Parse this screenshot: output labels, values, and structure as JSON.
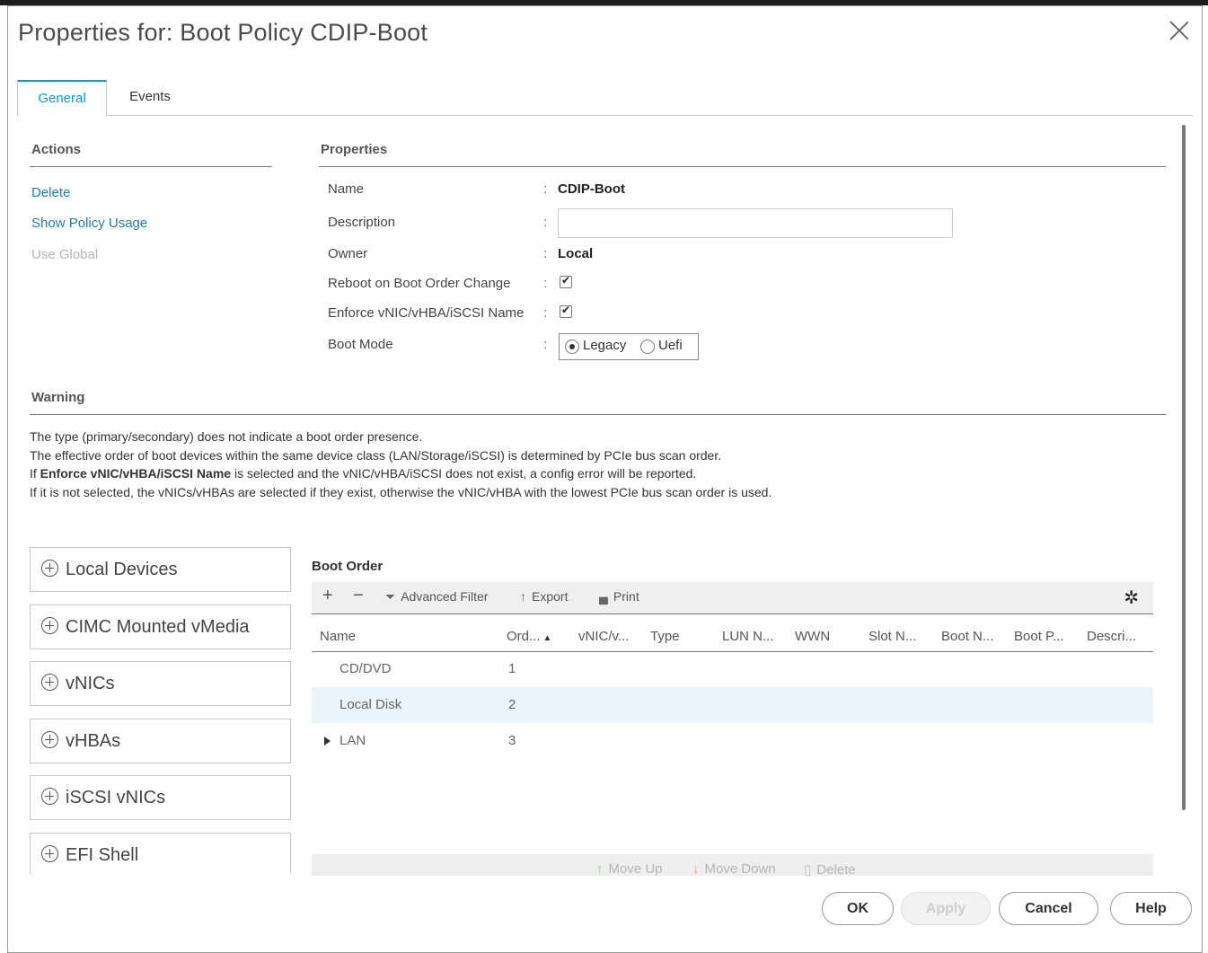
{
  "dialog": {
    "title": "Properties for: Boot Policy CDIP-Boot"
  },
  "tabs": [
    {
      "label": "General",
      "active": true
    },
    {
      "label": "Events",
      "active": false
    }
  ],
  "actions": {
    "header": "Actions",
    "items": [
      {
        "label": "Delete",
        "enabled": true
      },
      {
        "label": "Show Policy Usage",
        "enabled": true
      },
      {
        "label": "Use Global",
        "enabled": false
      }
    ]
  },
  "properties": {
    "header": "Properties",
    "name_label": "Name",
    "name_value": "CDIP-Boot",
    "description_label": "Description",
    "description_value": "",
    "owner_label": "Owner",
    "owner_value": "Local",
    "reboot_label": "Reboot on Boot Order Change",
    "reboot_checked": true,
    "enforce_label": "Enforce vNIC/vHBA/iSCSI Name",
    "enforce_checked": true,
    "boot_mode_label": "Boot Mode",
    "boot_mode_options": [
      "Legacy",
      "Uefi"
    ],
    "boot_mode_selected": "Legacy"
  },
  "warning": {
    "header": "Warning",
    "line1": "The type (primary/secondary) does not indicate a boot order presence.",
    "line2": "The effective order of boot devices within the same device class (LAN/Storage/iSCSI) is determined by PCIe bus scan order.",
    "line3_prefix": "If ",
    "line3_bold": "Enforce vNIC/vHBA/iSCSI Name",
    "line3_suffix": " is selected and the vNIC/vHBA/iSCSI does not exist, a config error will be reported.",
    "line4": "If it is not selected, the vNICs/vHBAs are selected if they exist, otherwise the vNIC/vHBA with the lowest PCIe bus scan order is used."
  },
  "devices": [
    "Local Devices",
    "CIMC Mounted vMedia",
    "vNICs",
    "vHBAs",
    "iSCSI vNICs",
    "EFI Shell"
  ],
  "boot_order": {
    "title": "Boot Order",
    "toolbar": {
      "add": "+",
      "remove": "−",
      "advanced_filter": "Advanced Filter",
      "export": "Export",
      "print": "Print"
    },
    "columns": [
      "Name",
      "Ord...",
      "vNIC/v...",
      "Type",
      "LUN N...",
      "WWN",
      "Slot N...",
      "Boot N...",
      "Boot P...",
      "Descri..."
    ],
    "sort_indicator": "▲",
    "rows": [
      {
        "name": "CD/DVD",
        "order": "1",
        "expandable": false,
        "selected": false
      },
      {
        "name": "Local Disk",
        "order": "2",
        "expandable": false,
        "selected": true
      },
      {
        "name": "LAN",
        "order": "3",
        "expandable": true,
        "selected": false
      }
    ],
    "bottom_actions": {
      "move_up": "Move Up",
      "move_down": "Move Down",
      "delete": "Delete"
    }
  },
  "footer": {
    "ok": "OK",
    "apply": "Apply",
    "cancel": "Cancel",
    "help": "Help"
  },
  "colors": {
    "accent": "#049fd9",
    "link": "#1f7eb4",
    "selected_row": "#eaf4fa"
  }
}
